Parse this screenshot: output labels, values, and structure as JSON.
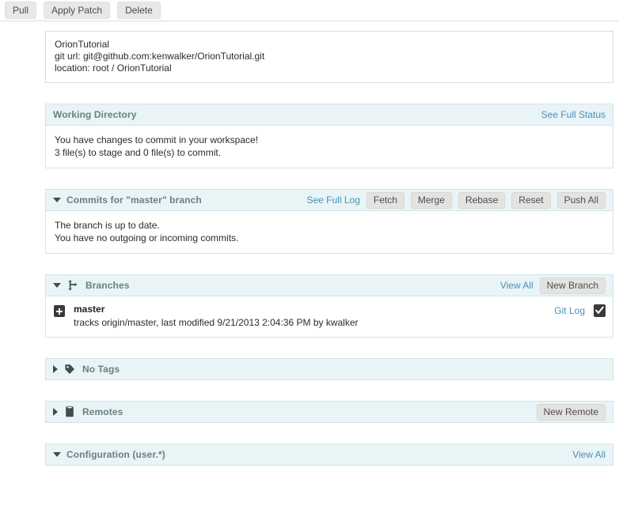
{
  "toolbar": {
    "buttons": [
      {
        "label": "Pull",
        "name": "pull-button"
      },
      {
        "label": "Apply Patch",
        "name": "apply-patch-button"
      },
      {
        "label": "Delete",
        "name": "delete-button"
      }
    ]
  },
  "repository": {
    "name": "OrionTutorial",
    "git_url_label": "git url: git@github.com:kenwalker/OrionTutorial.git",
    "location_label": "location: root / OrionTutorial"
  },
  "working_directory": {
    "title": "Working Directory",
    "see_full_status": "See Full Status",
    "line1": "You have changes to commit in your workspace!",
    "line2": "3 file(s) to stage and 0 file(s) to commit."
  },
  "commits": {
    "title": "Commits for \"master\" branch",
    "see_full_log": "See Full Log",
    "buttons": [
      {
        "label": "Fetch",
        "name": "fetch-button"
      },
      {
        "label": "Merge",
        "name": "merge-button"
      },
      {
        "label": "Rebase",
        "name": "rebase-button"
      },
      {
        "label": "Reset",
        "name": "reset-button"
      },
      {
        "label": "Push All",
        "name": "push-all-button"
      }
    ],
    "line1": "The branch is up to date.",
    "line2": "You have no outgoing or incoming commits."
  },
  "branches": {
    "title": "Branches",
    "view_all": "View All",
    "new_branch": "New Branch",
    "rows": [
      {
        "name": "master",
        "details": "tracks origin/master, last modified 9/21/2013 2:04:36 PM by kwalker",
        "git_log": "Git Log"
      }
    ]
  },
  "tags": {
    "title": "No Tags"
  },
  "remotes": {
    "title": "Remotes",
    "new_remote": "New Remote"
  },
  "configuration": {
    "title": "Configuration (user.*)",
    "view_all": "View All"
  },
  "colors": {
    "panel_header_bg": "#e9f4f6",
    "panel_border": "#d3e3e8",
    "link": "#4a90b8",
    "button_bg": "#e3e3e1",
    "title_text": "#6d7d82"
  }
}
